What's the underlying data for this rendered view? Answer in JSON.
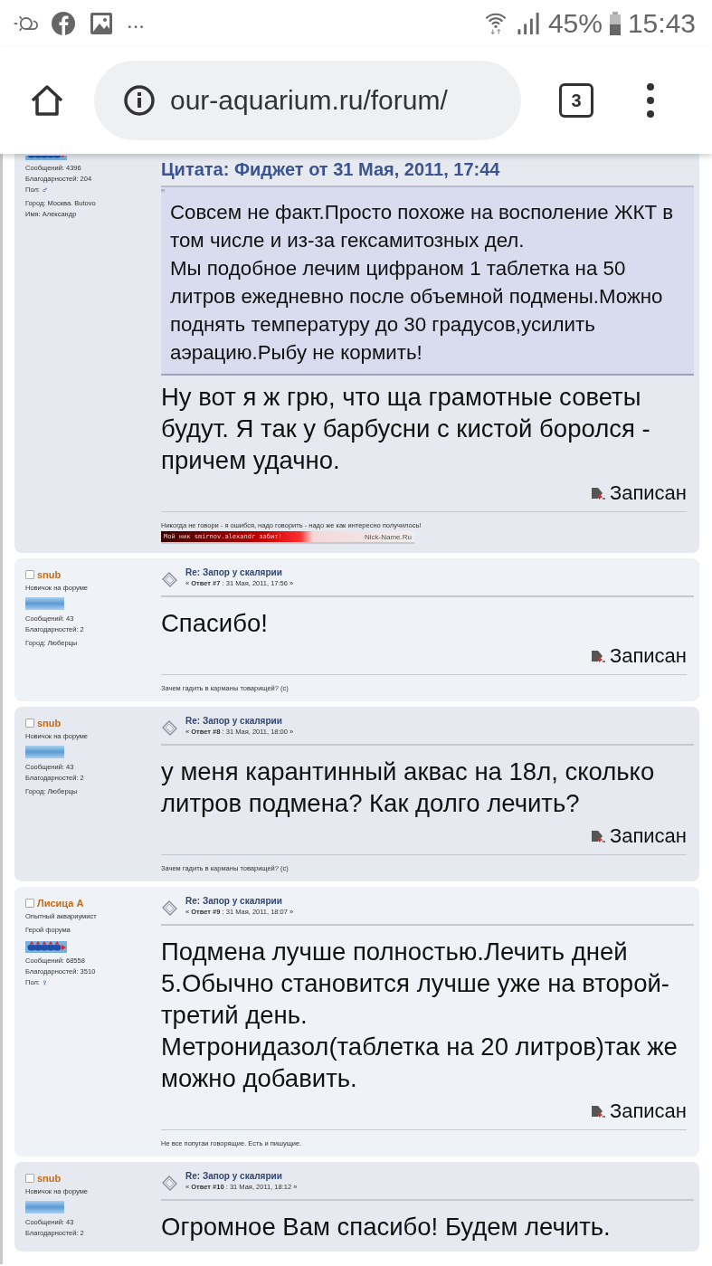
{
  "status_bar": {
    "left_more": "...",
    "battery": "45%",
    "time": "15:43"
  },
  "browser": {
    "url": "our-aquarium.ru/forum/",
    "tab_count": "3"
  },
  "posts": [
    {
      "author": {
        "rank_badge": {
          "kind": "fish"
        },
        "partial_top": true,
        "stats": [
          {
            "text": "Сообщений: 4396"
          },
          {
            "text": "Благодарностей: 204"
          },
          {
            "text": "Пол:",
            "symbol": "♂"
          }
        ],
        "profile": [
          "Город: Москва. Butovo",
          "Имя: Александр"
        ]
      },
      "quote": {
        "header": "Цитата: Фиджет от 31 Мая, 2011, 17:44",
        "mark": "‟",
        "text": "Совсем не факт.Просто похоже на восполение ЖКТ в том числе и из-за гексамитозных дел.\nМы подобное лечим цифраном 1 таблетка на 50 литров ежедневно после объемной подмены.Можно поднять температуру до 30 градусов,усилить аэрацию.Рыбу не кормить!"
      },
      "body": "Ну вот я ж грю, что ща грамотные советы будут. Я так у барбусни с кистой боролся - причем удачно.",
      "recorded": "Записан",
      "signature": "Никогда не говори - я ошибся, надо говорить - надо же как интересно получилось!",
      "banner": {
        "text": "Мой ник smirnov.alexandr забит!",
        "site": "Nick-Name.Ru"
      }
    },
    {
      "author": {
        "name": "snub",
        "ranks": [
          "Новичок на форуме"
        ],
        "rank_badge": {
          "kind": "bar"
        },
        "stats": [
          {
            "text": "Сообщений: 43"
          },
          {
            "text": "Благодарностей: 2"
          }
        ],
        "profile": [
          "Город: Люберцы"
        ]
      },
      "header": {
        "title": "Re: Запор у скалярии",
        "meta": "« **Ответ #7** : 31 Мая, 2011, 17:56 »"
      },
      "body": "Спасибо!",
      "recorded": "Записан",
      "signature": "Зачем гадить в карманы товарищей? (с)"
    },
    {
      "author": {
        "name": "snub",
        "ranks": [
          "Новичок на форуме"
        ],
        "rank_badge": {
          "kind": "bar"
        },
        "stats": [
          {
            "text": "Сообщений: 43"
          },
          {
            "text": "Благодарностей: 2"
          }
        ],
        "profile": [
          "Город: Люберцы"
        ]
      },
      "header": {
        "title": "Re: Запор у скалярии",
        "meta": "« **Ответ #8** : 31 Мая, 2011, 18:00 »"
      },
      "body": "у меня карантинный аквас на 18л, сколько литров подмена? Как долго лечить?",
      "recorded": "Записан",
      "signature": "Зачем гадить в карманы товарищей? (с)"
    },
    {
      "author": {
        "name": "Лисица А",
        "ranks": [
          "Опытный аквариумист",
          "Герой форума"
        ],
        "rank_badge": {
          "kind": "fish"
        },
        "stats": [
          {
            "text": "Сообщений: 68558"
          },
          {
            "text": "Благодарностей: 3510"
          },
          {
            "text": "Пол:",
            "symbol": "♀"
          }
        ]
      },
      "header": {
        "title": "Re: Запор у скалярии",
        "meta": "« **Ответ #9** : 31 Мая, 2011, 18:07 »"
      },
      "body": "Подмена лучше полностью.Лечить дней 5.Обычно становится лучше уже на второй-третий день.\nМетронидазол(таблетка на 20 литров)так же можно добавить.",
      "recorded": "Записан",
      "signature": "Не все попугаи говорящие. Есть и пишущие."
    },
    {
      "author": {
        "name": "snub",
        "ranks": [
          "Новичок на форуме"
        ],
        "rank_badge": {
          "kind": "bar"
        },
        "stats": [
          {
            "text": "Сообщений: 43"
          },
          {
            "text": "Благодарностей: 2"
          }
        ]
      },
      "header": {
        "title": "Re: Запор у скалярии",
        "meta": "« **Ответ #10** : 31 Мая, 2011, 18:12 »"
      },
      "body": "Огромное Вам спасибо! Будем лечить."
    }
  ]
}
